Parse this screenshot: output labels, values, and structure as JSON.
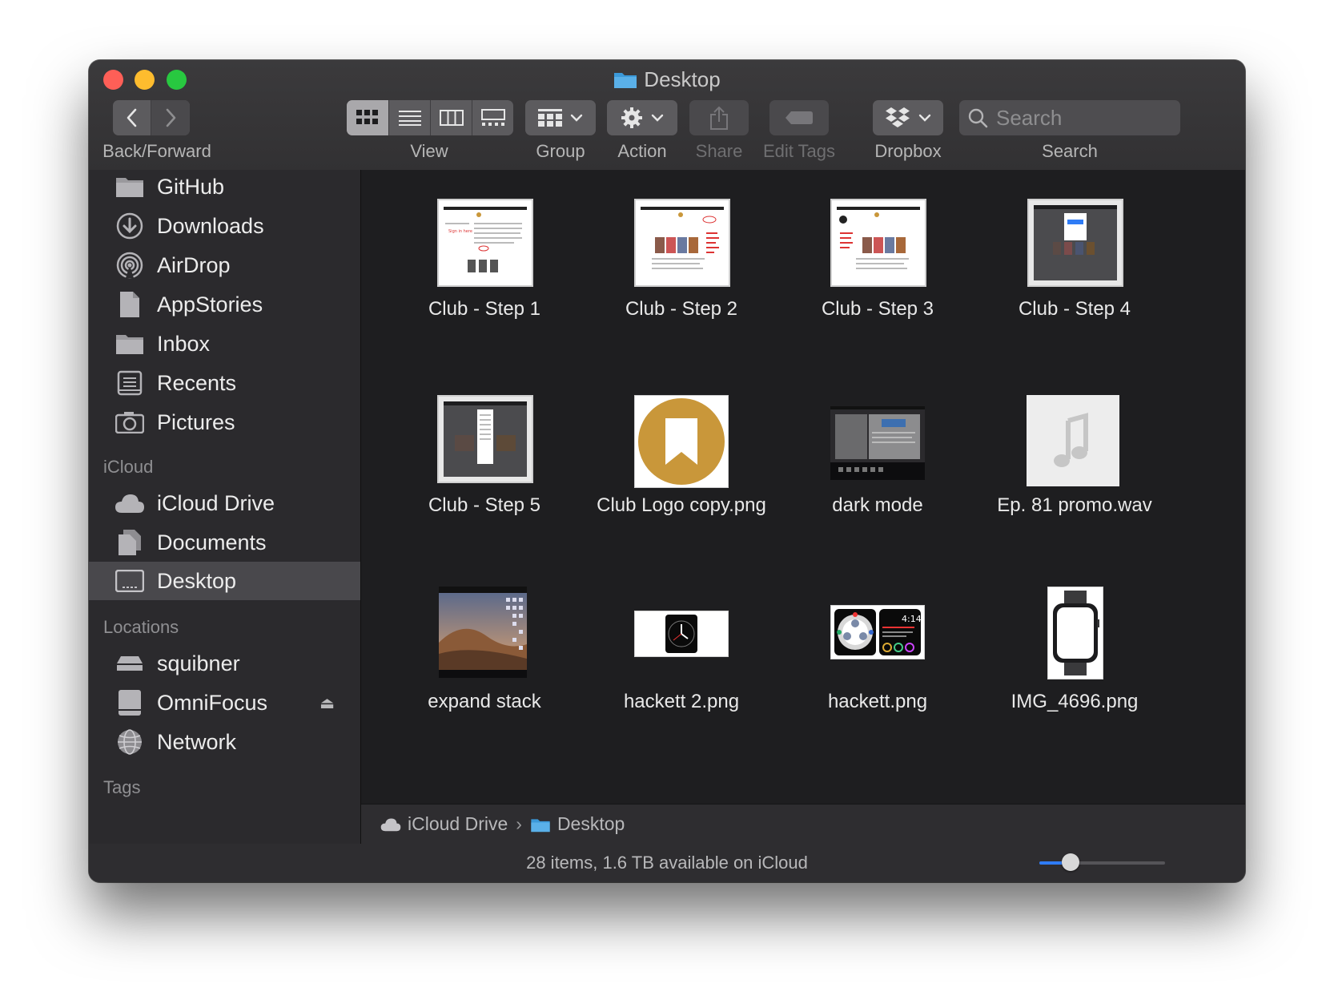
{
  "window": {
    "title": "Desktop"
  },
  "toolbar": {
    "back_forward_label": "Back/Forward",
    "view_label": "View",
    "group_label": "Group",
    "action_label": "Action",
    "share_label": "Share",
    "edit_tags_label": "Edit Tags",
    "dropbox_label": "Dropbox",
    "search_label": "Search",
    "search_placeholder": "Search"
  },
  "sidebar": {
    "favorites": [
      {
        "label": "GitHub",
        "icon": "folder-icon"
      },
      {
        "label": "Downloads",
        "icon": "download-icon"
      },
      {
        "label": "AirDrop",
        "icon": "airdrop-icon"
      },
      {
        "label": "AppStories",
        "icon": "document-icon"
      },
      {
        "label": "Inbox",
        "icon": "folder-icon"
      },
      {
        "label": "Recents",
        "icon": "recents-icon"
      },
      {
        "label": "Pictures",
        "icon": "camera-icon"
      }
    ],
    "icloud_header": "iCloud",
    "icloud": [
      {
        "label": "iCloud Drive",
        "icon": "cloud-icon"
      },
      {
        "label": "Documents",
        "icon": "documents-icon"
      },
      {
        "label": "Desktop",
        "icon": "desktop-icon",
        "selected": true
      }
    ],
    "locations_header": "Locations",
    "locations": [
      {
        "label": "squibner",
        "icon": "drive-icon"
      },
      {
        "label": "OmniFocus",
        "icon": "disk-icon"
      },
      {
        "label": "Network",
        "icon": "globe-icon"
      }
    ],
    "eject_glyph": "⏏",
    "tags_header": "Tags"
  },
  "files": [
    {
      "name": "Club - Step 1"
    },
    {
      "name": "Club - Step 2"
    },
    {
      "name": "Club - Step 3"
    },
    {
      "name": "Club - Step 4"
    },
    {
      "name": "Club - Step 5"
    },
    {
      "name": "Club Logo copy.png"
    },
    {
      "name": "dark mode"
    },
    {
      "name": "Ep. 81 promo.wav"
    },
    {
      "name": "expand stack"
    },
    {
      "name": "hackett 2.png"
    },
    {
      "name": "hackett.png"
    },
    {
      "name": "IMG_4696.png"
    }
  ],
  "thumb_text": {
    "watch_time": "4:14"
  },
  "pathbar": {
    "items": [
      "iCloud Drive",
      "Desktop"
    ],
    "separator": "›"
  },
  "status": {
    "text": "28 items, 1.6 TB available on iCloud",
    "icon_size": 0.25
  },
  "colors": {
    "accent": "#2f7cf6",
    "logo_gold": "#c9973a",
    "folder_blue": "#3b99d9"
  }
}
